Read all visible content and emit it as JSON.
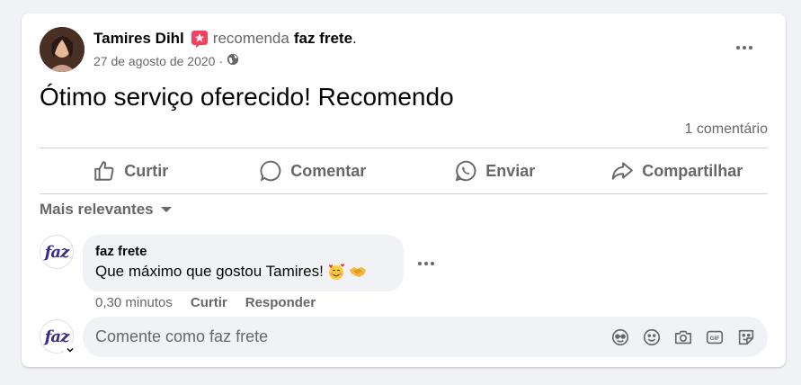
{
  "post": {
    "author": "Tamires Dihl",
    "recommends_text": "recomenda",
    "page_name": "faz frete",
    "period": ".",
    "date": "27 de agosto de 2020",
    "date_separator": "·",
    "text": "Ótimo serviço oferecido! Recomendo",
    "comment_count": "1 comentário"
  },
  "actions": {
    "like": "Curtir",
    "comment": "Comentar",
    "send": "Enviar",
    "share": "Compartilhar"
  },
  "sort": {
    "label": "Mais relevantes"
  },
  "comment": {
    "avatar_logo": "faz",
    "author": "faz frete",
    "text": "Que máximo que gostou Tamires!",
    "time": "0,30 minutos",
    "like": "Curtir",
    "reply": "Responder"
  },
  "composer": {
    "avatar_logo": "faz",
    "placeholder": "Comente como faz frete",
    "icons": [
      "avatar-sticker-icon",
      "emoji-icon",
      "camera-icon",
      "gif-icon",
      "sticker-icon"
    ]
  },
  "colors": {
    "accent_badge": "#f3425f",
    "secondary_text": "#65676b",
    "brand_logo": "#3a2b8c"
  }
}
